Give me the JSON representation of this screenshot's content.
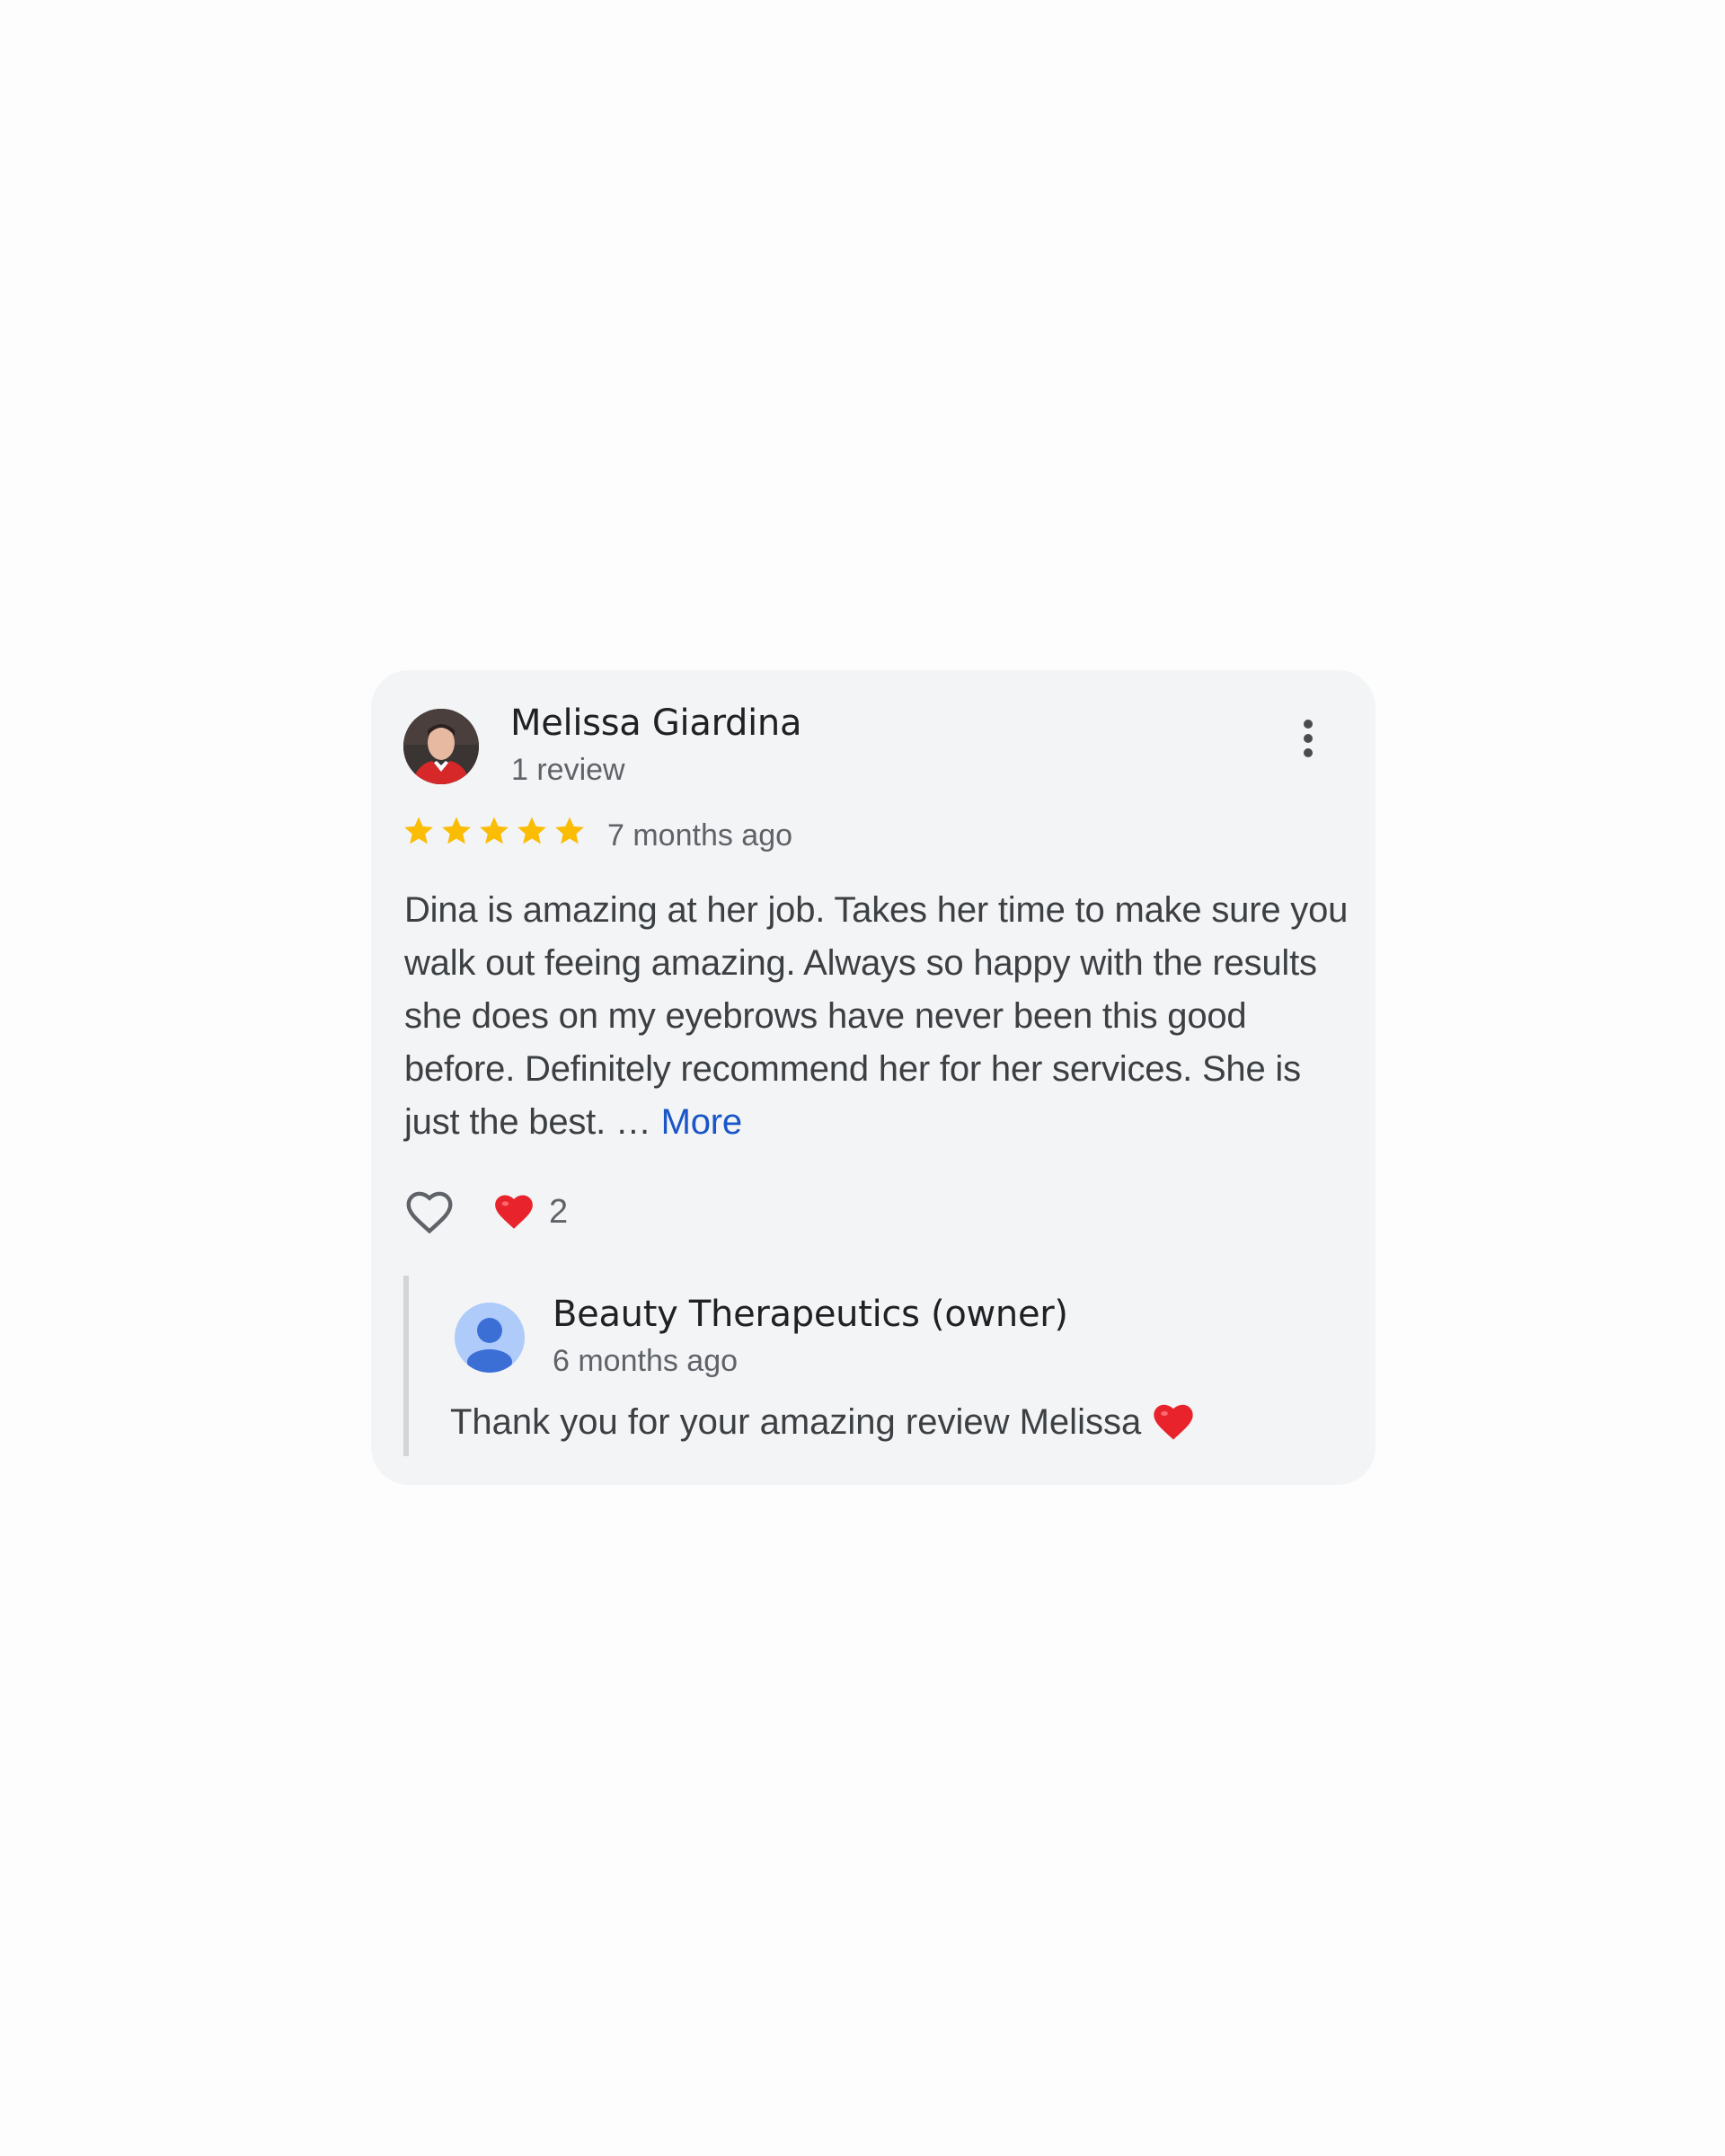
{
  "review": {
    "reviewer_name": "Melissa Giardina",
    "review_count": "1 review",
    "rating": 5,
    "rating_max": 5,
    "date": "7 months ago",
    "text": "Dina is amazing at her job. Takes her time to make sure you walk out feeing amazing. Always so happy with the results she does on my eyebrows have never been this good before. Definitely recommend her for her services. She is just the best. …",
    "more_label": "More",
    "reaction_count": "2"
  },
  "owner_reply": {
    "name": "Beauty Therapeutics (owner)",
    "date": "6 months ago",
    "text": "Thank you for your amazing review Melissa"
  },
  "colors": {
    "star": "#fbbc04",
    "link": "#1a56c7",
    "heart": "#e8232b",
    "card_bg": "#f3f4f6"
  },
  "icons": {
    "menu": "more-vert-icon",
    "like": "heart-outline-icon",
    "reaction": "red-heart-icon",
    "owner_avatar": "default-person-icon"
  }
}
